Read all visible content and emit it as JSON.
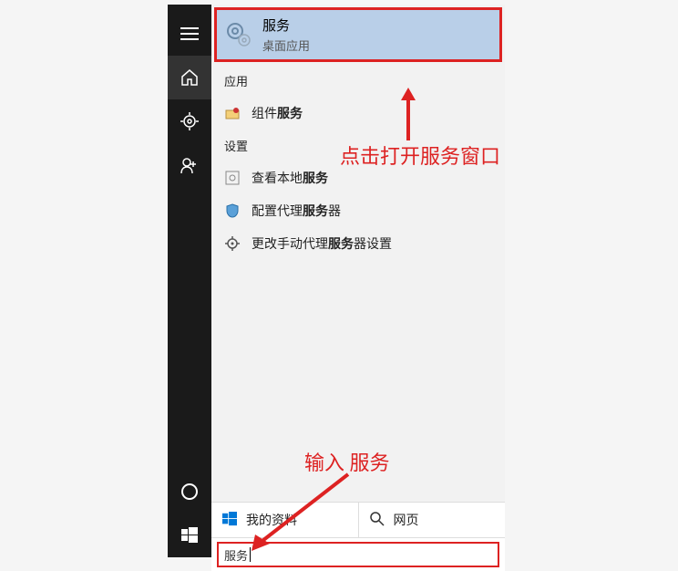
{
  "best_match": {
    "title": "服务",
    "subtitle": "桌面应用"
  },
  "sections": {
    "apps_header": "应用",
    "settings_header": "设置"
  },
  "apps": [
    {
      "pre": "组件",
      "hl": "服务",
      "post": ""
    }
  ],
  "settings": [
    {
      "pre": "查看本地",
      "hl": "服务",
      "post": ""
    },
    {
      "pre": "配置代理",
      "hl": "服务",
      "post": "器"
    },
    {
      "pre": "更改手动代理",
      "hl": "服务",
      "post": "器设置"
    }
  ],
  "tabs": {
    "my_stuff": "我的资料",
    "web": "网页"
  },
  "search": {
    "value": "服务"
  },
  "annotations": {
    "click_open": "点击打开服务窗口",
    "type_services": "输入 服务"
  },
  "colors": {
    "highlight_red": "#d22",
    "selected_bg": "#b9cfe8"
  }
}
